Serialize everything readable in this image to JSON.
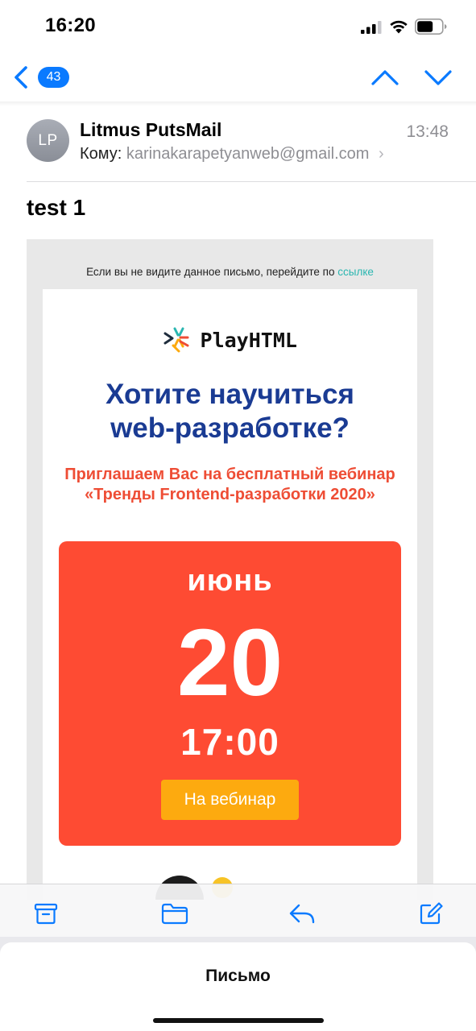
{
  "status_bar": {
    "time": "16:20",
    "battery_level": 0.65
  },
  "nav": {
    "unread_count": "43",
    "accent": "#0a7aff"
  },
  "header": {
    "avatar_initials": "LP",
    "sender": "Litmus PutsMail",
    "time": "13:48",
    "to_label": "Кому:",
    "to_address": "karinakarapetyanweb@gmail.com",
    "chevron": "›"
  },
  "subject": "test 1",
  "email": {
    "preheader_text": "Если вы не видите данное письмо, перейдите по ",
    "preheader_link": "ссылке",
    "logo_text": "PlayHTML",
    "headline_line1": "Хотите научиться",
    "headline_line2": "web-разработке?",
    "subhead": "Приглашаем Вас на бесплатный вебинар «Тренды Frontend-разработки 2020»",
    "event": {
      "month": "июнь",
      "day": "20",
      "time": "17:00",
      "button_label": "На вебинар"
    },
    "colors": {
      "headline": "#1a3b93",
      "subhead": "#ee4d35",
      "event_bg": "#fe4b33",
      "button_bg": "#fdaa0f",
      "link": "#2ab6b0"
    }
  },
  "toolbar": {
    "icons": [
      "archive-icon",
      "folder-icon",
      "reply-icon",
      "compose-icon"
    ]
  },
  "sheet": {
    "title": "Письмо"
  }
}
